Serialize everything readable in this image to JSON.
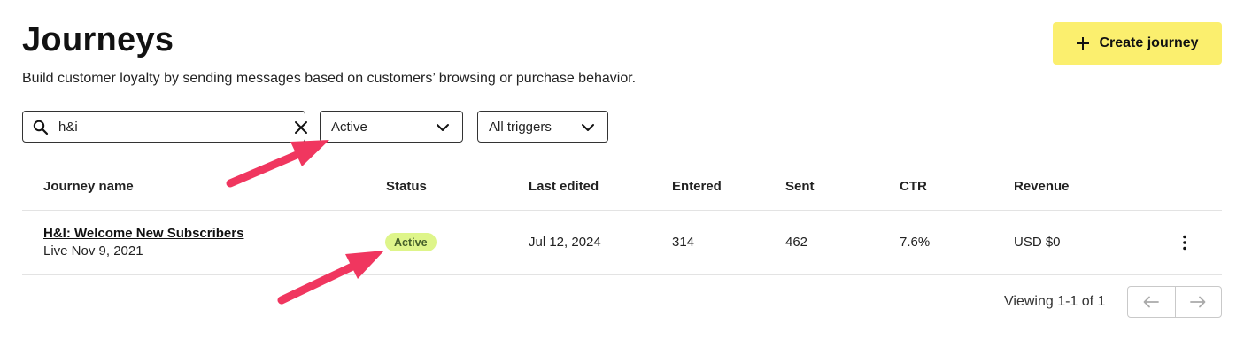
{
  "header": {
    "title": "Journeys",
    "subtitle": "Build customer loyalty by sending messages based on customers’ browsing or purchase behavior.",
    "create_label": "Create journey"
  },
  "filters": {
    "search_value": "h&i",
    "status_value": "Active",
    "trigger_value": "All triggers"
  },
  "table": {
    "columns": [
      "Journey name",
      "Status",
      "Last edited",
      "Entered",
      "Sent",
      "CTR",
      "Revenue"
    ],
    "rows": [
      {
        "name": "H&I: Welcome New Subscribers",
        "live": "Live Nov 9, 2021",
        "status": "Active",
        "last_edited": "Jul 12, 2024",
        "entered": "314",
        "sent": "462",
        "ctr": "7.6%",
        "revenue": "USD $0"
      }
    ]
  },
  "pagination": {
    "viewing": "Viewing 1-1 of 1"
  },
  "colors": {
    "accent_button": "#fbef6e",
    "badge_bg": "#def58a",
    "annotation_arrow": "#f0365f"
  },
  "icons": [
    "plus-icon",
    "search-icon",
    "clear-icon",
    "chevron-down-icon",
    "more-vertical-icon",
    "arrow-left-icon",
    "arrow-right-icon"
  ]
}
